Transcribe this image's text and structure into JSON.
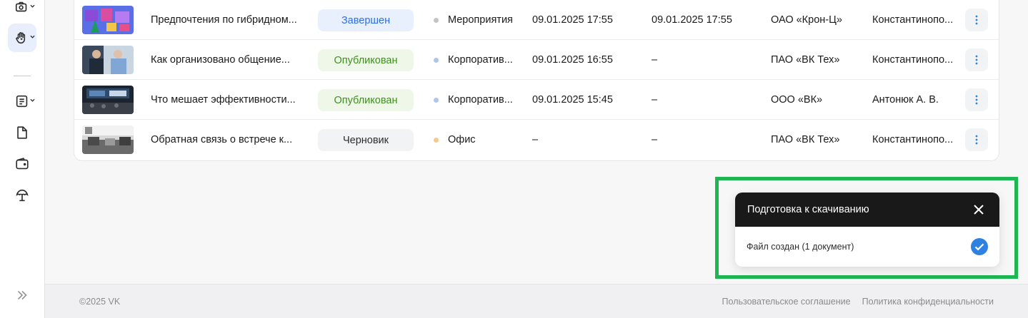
{
  "colors": {
    "accent": "#2d81e0",
    "status_done_bg": "#e8f0fe",
    "status_done_fg": "#2d6fe0",
    "status_published_bg": "#eef7e8",
    "status_published_fg": "#3f8f1f",
    "status_draft_bg": "#f2f3f5",
    "status_draft_fg": "#2c2d2e",
    "highlight": "#1fb553"
  },
  "sidebar": {
    "items": [
      {
        "icon": "camera-icon"
      },
      {
        "icon": "hand-heart-icon"
      },
      {
        "icon": "list-document-icon"
      },
      {
        "icon": "file-icon"
      },
      {
        "icon": "wallet-icon"
      },
      {
        "icon": "beach-umbrella-icon"
      },
      {
        "icon": "expand-sidebar-icon"
      }
    ]
  },
  "table": {
    "rows": [
      {
        "title": "Предпочтения по гибридном...",
        "status": "Завершен",
        "status_type": "done",
        "category": "Мероприятия",
        "category_dot": "#c4c4c8",
        "date_start": "09.01.2025 17:55",
        "date_end": "09.01.2025 17:55",
        "organization": "ОАО «Крон-Ц»",
        "author": "Константинопо..."
      },
      {
        "title": "Как организовано общение...",
        "status": "Опубликован",
        "status_type": "published",
        "category": "Корпоратив...",
        "category_dot": "#aec6ee",
        "date_start": "09.01.2025 16:55",
        "date_end": "–",
        "organization": "ПАО «ВК Тех»",
        "author": "Константинопо..."
      },
      {
        "title": "Что мешает эффективности...",
        "status": "Опубликован",
        "status_type": "published",
        "category": "Корпоратив...",
        "category_dot": "#aec6ee",
        "date_start": "09.01.2025 15:45",
        "date_end": "–",
        "organization": "ООО «ВК»",
        "author": "Антонюк А. В."
      },
      {
        "title": "Обратная связь о встрече к...",
        "status": "Черновик",
        "status_type": "draft",
        "category": "Офис",
        "category_dot": "#f5c98a",
        "date_start": "–",
        "date_end": "–",
        "organization": "ПАО «ВК Тех»",
        "author": "Константинопо..."
      }
    ]
  },
  "toast": {
    "title": "Подготовка к скачиванию",
    "message": "Файл создан (1 документ)"
  },
  "footer": {
    "copyright": "©2025 VK",
    "links": [
      "Пользовательское соглашение",
      "Политика конфиденциальности"
    ]
  }
}
